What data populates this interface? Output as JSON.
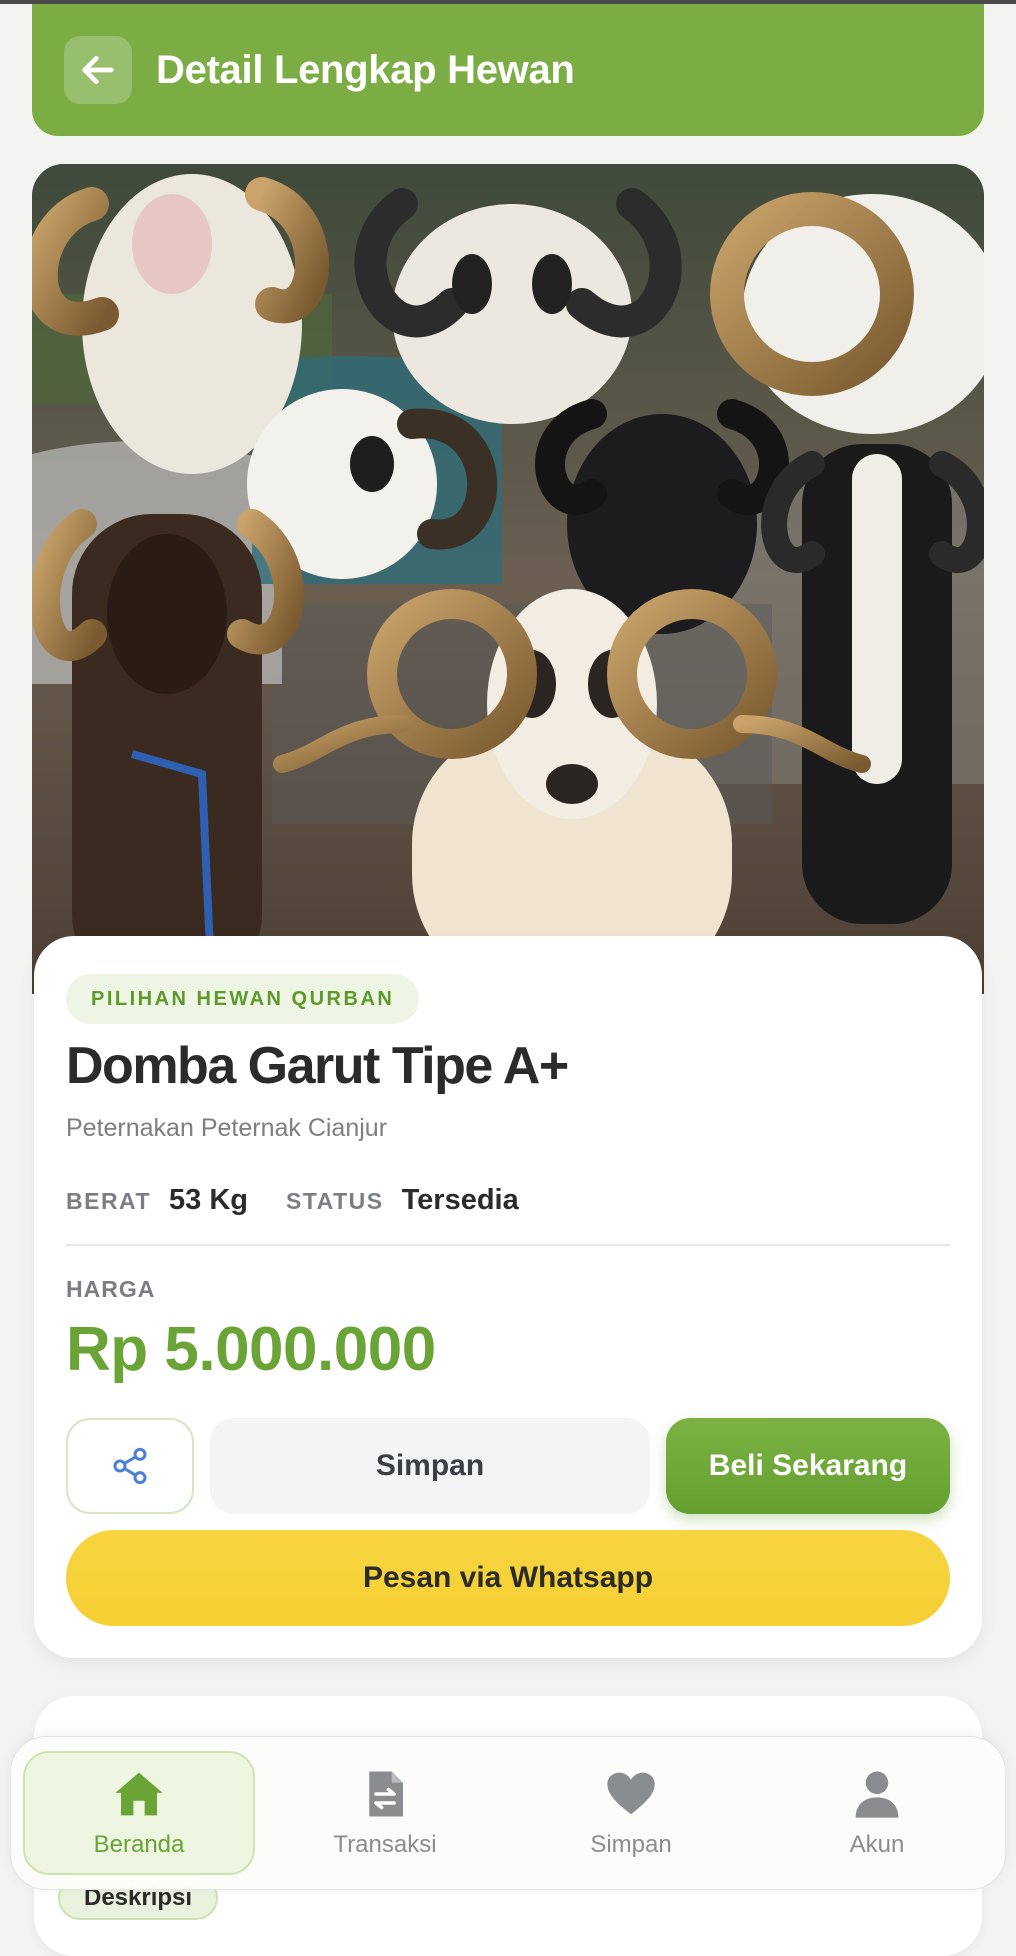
{
  "header": {
    "title": "Detail Lengkap Hewan",
    "back_icon": "arrow-left-icon"
  },
  "product": {
    "category": "PILIHAN HEWAN QURBAN",
    "name": "Domba Garut Tipe A+",
    "farm": "Peternakan Peternak Cianjur",
    "weight_label": "BERAT",
    "weight_value": "53 Kg",
    "status_label": "STATUS",
    "status_value": "Tersedia",
    "price_label": "HARGA",
    "price": "Rp 5.000.000"
  },
  "actions": {
    "share_icon": "share-icon",
    "save_label": "Simpan",
    "buy_label": "Beli Sekarang",
    "whatsapp_label": "Pesan via Whatsapp"
  },
  "description": {
    "tab_label": "Deskripsi"
  },
  "bottom_nav": {
    "items": [
      {
        "label": "Beranda",
        "icon": "home-icon",
        "active": true
      },
      {
        "label": "Transaksi",
        "icon": "document-icon",
        "active": false
      },
      {
        "label": "Simpan",
        "icon": "heart-icon",
        "active": false
      },
      {
        "label": "Akun",
        "icon": "user-icon",
        "active": false
      }
    ]
  },
  "colors": {
    "brand_green": "#7cad44",
    "price_green": "#6aa436",
    "whatsapp_yellow": "#f6d03a"
  }
}
